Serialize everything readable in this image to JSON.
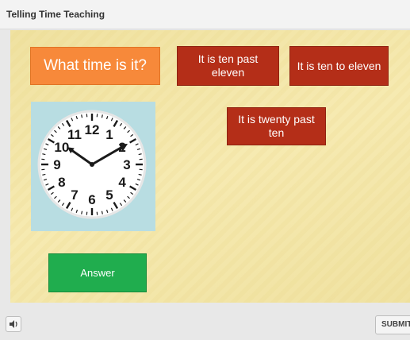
{
  "window": {
    "title": "Telling Time Teaching"
  },
  "question": {
    "text": "What time is it?"
  },
  "options": [
    {
      "label": "It is ten past eleven"
    },
    {
      "label": "It is ten to eleven"
    },
    {
      "label": "It is twenty past ten"
    }
  ],
  "clock": {
    "numerals": [
      "12",
      "1",
      "2",
      "3",
      "4",
      "5",
      "6",
      "7",
      "8",
      "9",
      "10",
      "11"
    ],
    "time_shown": {
      "hour": 10,
      "minute": 10
    }
  },
  "answer_button": {
    "label": "Answer"
  },
  "footer": {
    "submit_label": "SUBMIT",
    "speaker_icon": "speaker-icon"
  },
  "colors": {
    "question_bg": "#f7893a",
    "option_bg": "#b42e18",
    "answer_bg": "#20ad4e",
    "clock_panel_bg": "#b8dde2"
  }
}
